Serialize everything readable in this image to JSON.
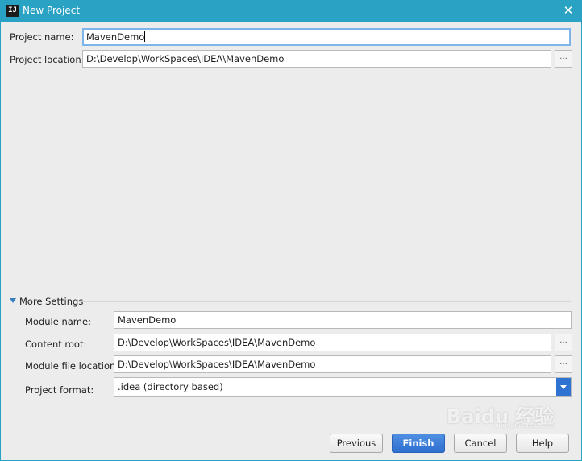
{
  "window": {
    "title": "New Project",
    "app_icon_text": "IJ",
    "close_glyph": "✕"
  },
  "project": {
    "name_label": "Project name:",
    "name_value": "MavenDemo",
    "location_label": "Project location:",
    "location_value": "D:\\Develop\\WorkSpaces\\IDEA\\MavenDemo",
    "browse_label": "..."
  },
  "more_settings": {
    "label": "More Settings",
    "expanded": true,
    "module_name_label": "Module name:",
    "module_name_value": "MavenDemo",
    "content_root_label": "Content root:",
    "content_root_value": "D:\\Develop\\WorkSpaces\\IDEA\\MavenDemo",
    "module_file_location_label": "Module file location:",
    "module_file_location_value": "D:\\Develop\\WorkSpaces\\IDEA\\MavenDemo",
    "project_format_label": "Project format:",
    "project_format_value": ".idea (directory based)",
    "browse_label": "..."
  },
  "buttons": {
    "previous": "Previous",
    "finish": "Finish",
    "cancel": "Cancel",
    "help": "Help"
  },
  "watermark": {
    "text": "Baidu 经验",
    "subtext": "jingyan.baidu.com"
  },
  "colors": {
    "titlebar": "#2aa2c3",
    "primary_button": "#2f6fcf",
    "focus_border": "#7fb4ea",
    "dropdown_accent": "#2f73d2"
  }
}
